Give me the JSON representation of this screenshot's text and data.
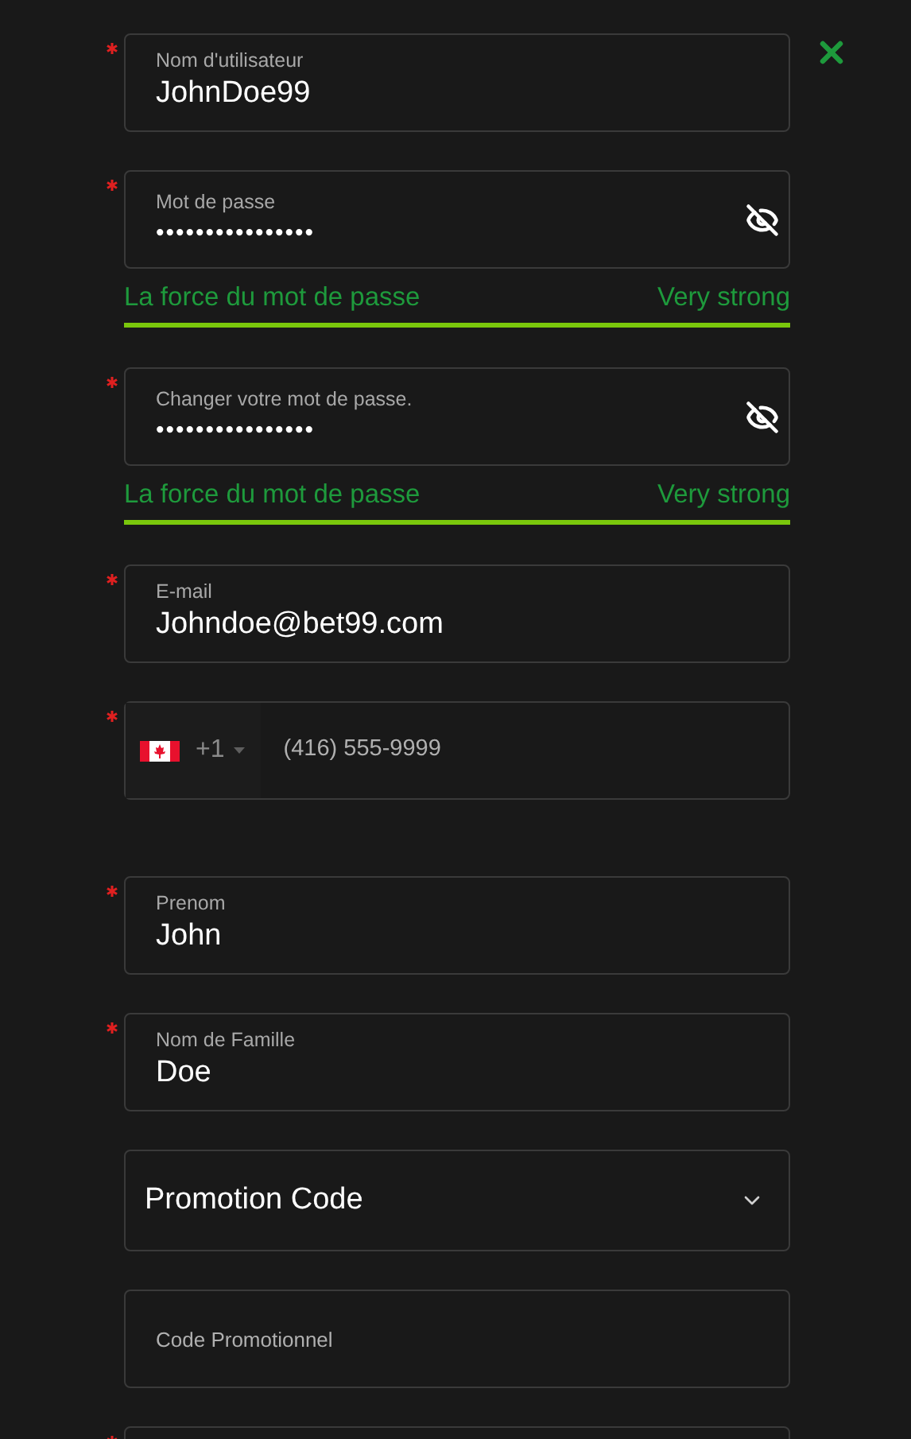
{
  "fields": [
    {
      "kind": "text",
      "required": true,
      "label": "Nom d'utilisateur",
      "value": "JohnDoe99"
    },
    {
      "kind": "password",
      "required": true,
      "label": "Mot de passe",
      "value": "••••••••••••••••",
      "strength": {
        "label": "La force du mot de passe",
        "value": "Very strong"
      }
    },
    {
      "kind": "password",
      "required": true,
      "label": "Changer votre mot de passe.",
      "value": "••••••••••••••••",
      "strength": {
        "label": "La force du mot de passe",
        "value": "Very strong"
      }
    },
    {
      "kind": "text",
      "required": true,
      "label": "E-mail",
      "value": "Johndoe@bet99.com"
    },
    {
      "kind": "phone",
      "required": true,
      "country_code": "+1",
      "value": "(416) 555-9999"
    },
    {
      "kind": "text",
      "required": true,
      "label": "Prenom",
      "value": "John"
    },
    {
      "kind": "text",
      "required": true,
      "label": "Nom de Famille",
      "value": "Doe"
    },
    {
      "kind": "select",
      "required": false,
      "value": "Promotion Code"
    },
    {
      "kind": "placeholder",
      "required": false,
      "placeholder": "Code Promotionnel"
    },
    {
      "kind": "partial",
      "required": true
    }
  ]
}
